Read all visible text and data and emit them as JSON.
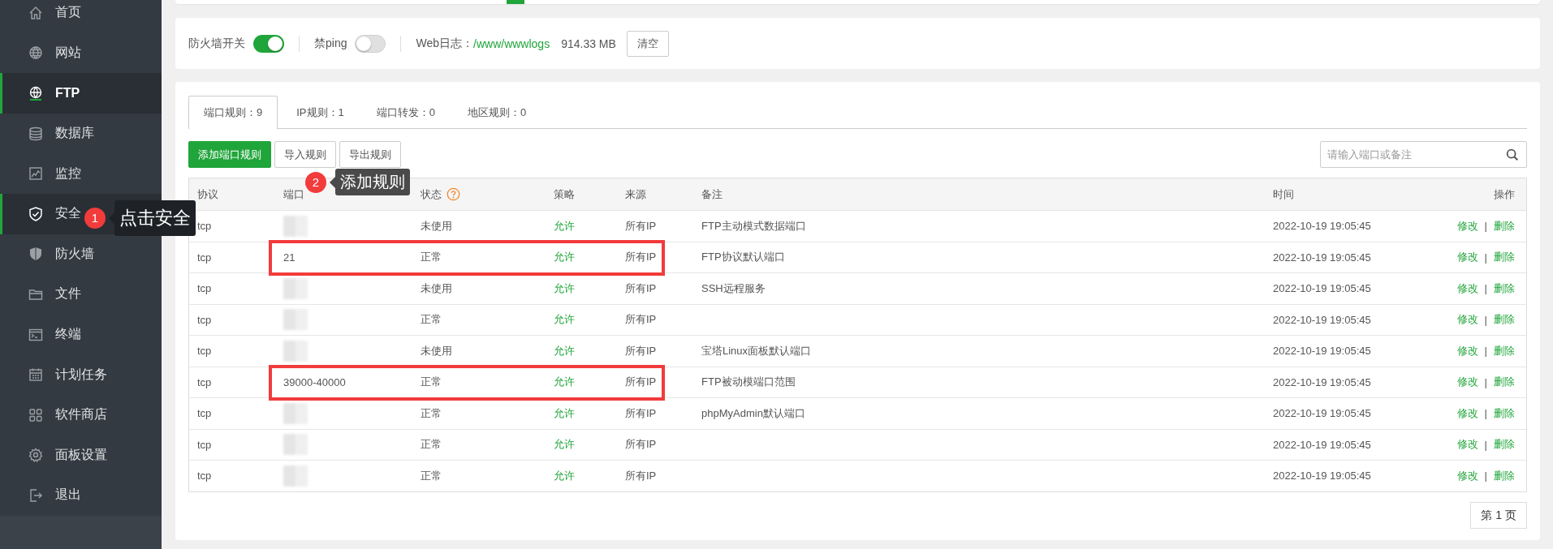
{
  "sidebar": {
    "items": [
      {
        "label": "首页",
        "selected": false,
        "hovered": false
      },
      {
        "label": "网站",
        "selected": false,
        "hovered": false
      },
      {
        "label": "FTP",
        "selected": true,
        "hovered": false
      },
      {
        "label": "数据库",
        "selected": false,
        "hovered": false
      },
      {
        "label": "监控",
        "selected": false,
        "hovered": false
      },
      {
        "label": "安全",
        "selected": false,
        "hovered": true
      },
      {
        "label": "防火墙",
        "selected": false,
        "hovered": false
      },
      {
        "label": "文件",
        "selected": false,
        "hovered": false
      },
      {
        "label": "终端",
        "selected": false,
        "hovered": false
      },
      {
        "label": "计划任务",
        "selected": false,
        "hovered": false
      },
      {
        "label": "软件商店",
        "selected": false,
        "hovered": false
      },
      {
        "label": "面板设置",
        "selected": false,
        "hovered": false
      },
      {
        "label": "退出",
        "selected": false,
        "hovered": false
      }
    ]
  },
  "settings": {
    "firewall": {
      "label": "防火墙开关",
      "on": true
    },
    "ping": {
      "label": "禁ping",
      "on": false
    },
    "web_log": {
      "label": "Web日志：",
      "path": "/www/wwwlogs",
      "size": "914.33 MB",
      "button": "清空"
    }
  },
  "tabs": [
    {
      "label": "端口规则：9",
      "selected": true
    },
    {
      "label": "IP规则：1",
      "selected": false
    },
    {
      "label": "端口转发：0",
      "selected": false
    },
    {
      "label": "地区规则：0",
      "selected": false
    }
  ],
  "toolbar": {
    "buttons": [
      {
        "label": "添加端口规则",
        "kind": "primary"
      },
      {
        "label": "导入规则",
        "kind": "default"
      },
      {
        "label": "导出规则",
        "kind": "default"
      }
    ],
    "search": {
      "placeholder": "请输入端口或备注"
    }
  },
  "table": {
    "columns": [
      {
        "label": "协议"
      },
      {
        "label": "端口"
      },
      {
        "label": "状态",
        "help": true
      },
      {
        "label": "策略"
      },
      {
        "label": "来源"
      },
      {
        "label": "备注"
      },
      {
        "label": "时间"
      },
      {
        "label": "操作"
      }
    ],
    "rows": [
      {
        "protocol": "tcp",
        "status": "未使用",
        "policy": "允许",
        "source": "所有IP",
        "note": "FTP主动模式数据端口",
        "time": "2022-10-19 19:05:45",
        "actions": {
          "edit": "修改",
          "separator": "|",
          "delete": "删除"
        },
        "highlighted": false
      },
      {
        "protocol": "tcp",
        "port": "21",
        "status": "正常",
        "policy": "允许",
        "source": "所有IP",
        "note": "FTP协议默认端口",
        "time": "2022-10-19 19:05:45",
        "actions": {
          "edit": "修改",
          "separator": "|",
          "delete": "删除"
        },
        "highlighted": true
      },
      {
        "protocol": "tcp",
        "status": "未使用",
        "policy": "允许",
        "source": "所有IP",
        "note": "SSH远程服务",
        "time": "2022-10-19 19:05:45",
        "actions": {
          "edit": "修改",
          "separator": "|",
          "delete": "删除"
        },
        "highlighted": false
      },
      {
        "protocol": "tcp",
        "status": "正常",
        "policy": "允许",
        "source": "所有IP",
        "time": "2022-10-19 19:05:45",
        "actions": {
          "edit": "修改",
          "separator": "|",
          "delete": "删除"
        },
        "highlighted": false
      },
      {
        "protocol": "tcp",
        "status": "未使用",
        "policy": "允许",
        "source": "所有IP",
        "note": "宝塔Linux面板默认端口",
        "time": "2022-10-19 19:05:45",
        "actions": {
          "edit": "修改",
          "separator": "|",
          "delete": "删除"
        },
        "highlighted": false
      },
      {
        "protocol": "tcp",
        "port": "39000-40000",
        "status": "正常",
        "policy": "允许",
        "source": "所有IP",
        "note": "FTP被动模端口范围",
        "time": "2022-10-19 19:05:45",
        "actions": {
          "edit": "修改",
          "separator": "|",
          "delete": "删除"
        },
        "highlighted": true
      },
      {
        "protocol": "tcp",
        "status": "正常",
        "policy": "允许",
        "source": "所有IP",
        "note": "phpMyAdmin默认端口",
        "time": "2022-10-19 19:05:45",
        "actions": {
          "edit": "修改",
          "separator": "|",
          "delete": "删除"
        },
        "highlighted": false
      },
      {
        "protocol": "tcp",
        "status": "正常",
        "policy": "允许",
        "source": "所有IP",
        "time": "2022-10-19 19:05:45",
        "actions": {
          "edit": "修改",
          "separator": "|",
          "delete": "删除"
        },
        "highlighted": false
      },
      {
        "protocol": "tcp",
        "status": "正常",
        "policy": "允许",
        "source": "所有IP",
        "time": "2022-10-19 19:05:45",
        "actions": {
          "edit": "修改",
          "separator": "|",
          "delete": "删除"
        },
        "highlighted": false
      }
    ]
  },
  "pagination": {
    "label": "第 1 页"
  },
  "annotations": [
    {
      "number": "1",
      "text": "点击安全"
    },
    {
      "number": "2",
      "text": "添加规则"
    }
  ]
}
